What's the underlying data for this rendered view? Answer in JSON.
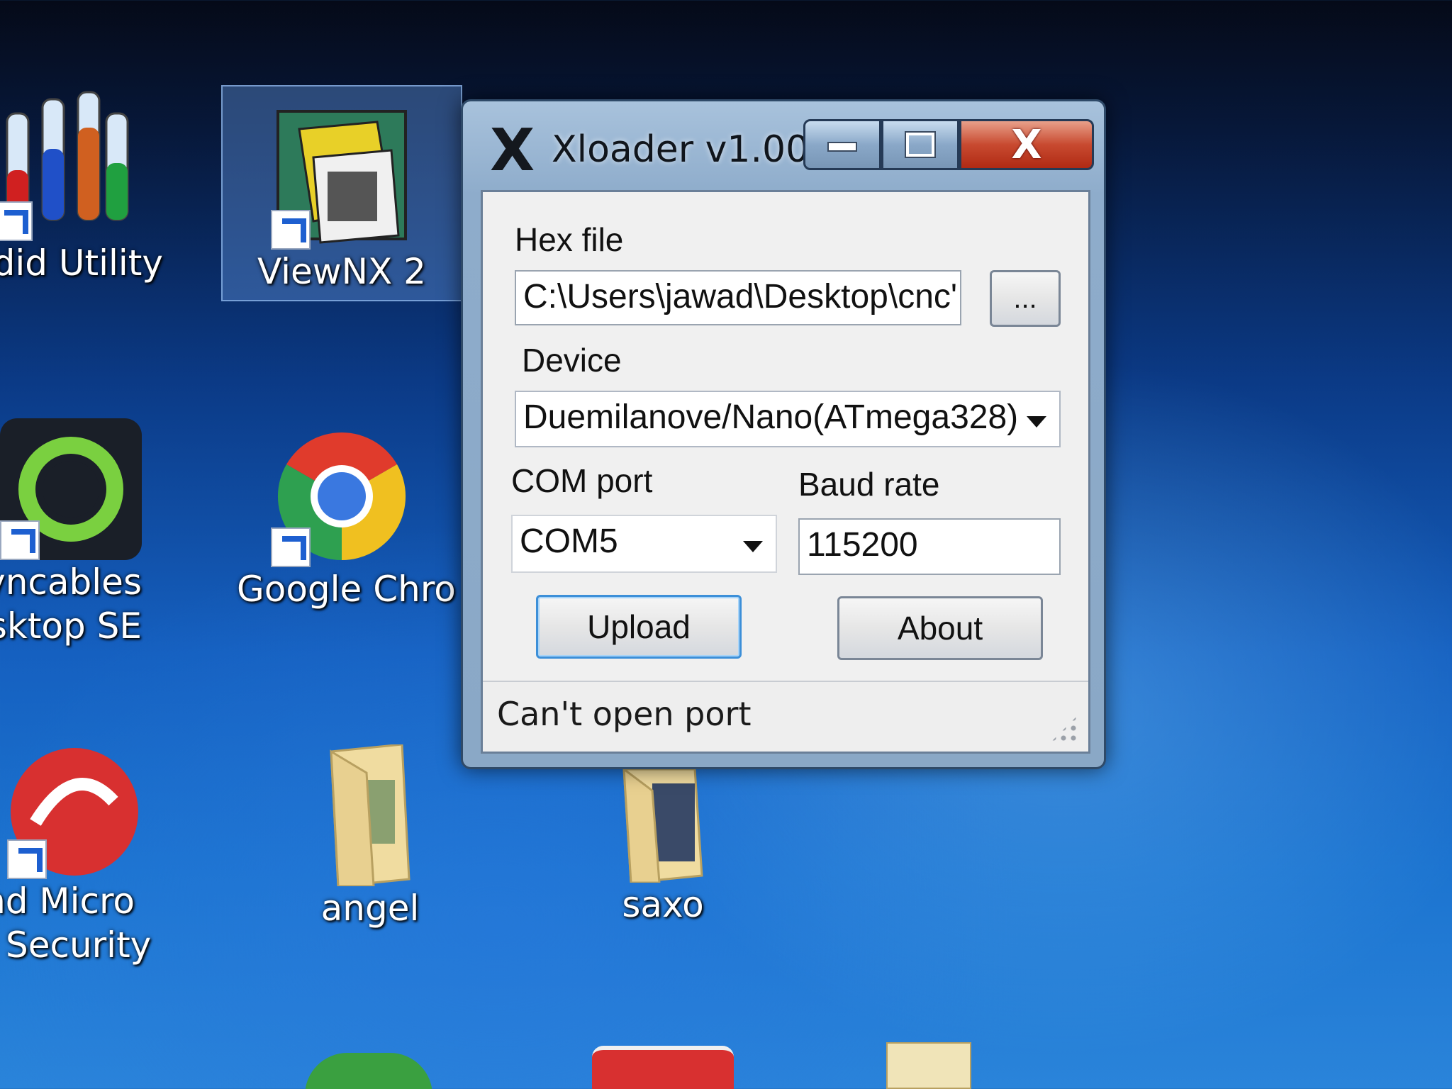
{
  "desktop": {
    "icons": [
      {
        "id": "candid",
        "lines": [
          "ndid Utility"
        ]
      },
      {
        "id": "viewnx",
        "lines": [
          "ViewNX 2"
        ]
      },
      {
        "id": "syncables",
        "lines": [
          "yncables",
          "esktop SE"
        ]
      },
      {
        "id": "chrome",
        "lines": [
          "Google Chro"
        ]
      },
      {
        "id": "trendmicro",
        "lines": [
          "end Micro",
          "net Security"
        ]
      },
      {
        "id": "angel",
        "lines": [
          "angel"
        ]
      },
      {
        "id": "saxo",
        "lines": [
          "saxo"
        ]
      }
    ]
  },
  "window": {
    "logo": "X",
    "title": "Xloader v1.00",
    "controls": {
      "close_glyph": "X"
    },
    "hex_file": {
      "label": "Hex file",
      "value": "C:\\Users\\jawad\\Desktop\\cnc'",
      "browse_label": "..."
    },
    "device": {
      "label": "Device",
      "selected": "Duemilanove/Nano(ATmega328)"
    },
    "com_port": {
      "label": "COM port",
      "selected": "COM5"
    },
    "baud_rate": {
      "label": "Baud rate",
      "value": "115200"
    },
    "buttons": {
      "upload": "Upload",
      "about": "About"
    },
    "status": "Can't open port"
  },
  "colors": {
    "close_button": "#c84a30",
    "focus_border": "#3c8fd8",
    "desktop_blue": "#1560c0"
  }
}
